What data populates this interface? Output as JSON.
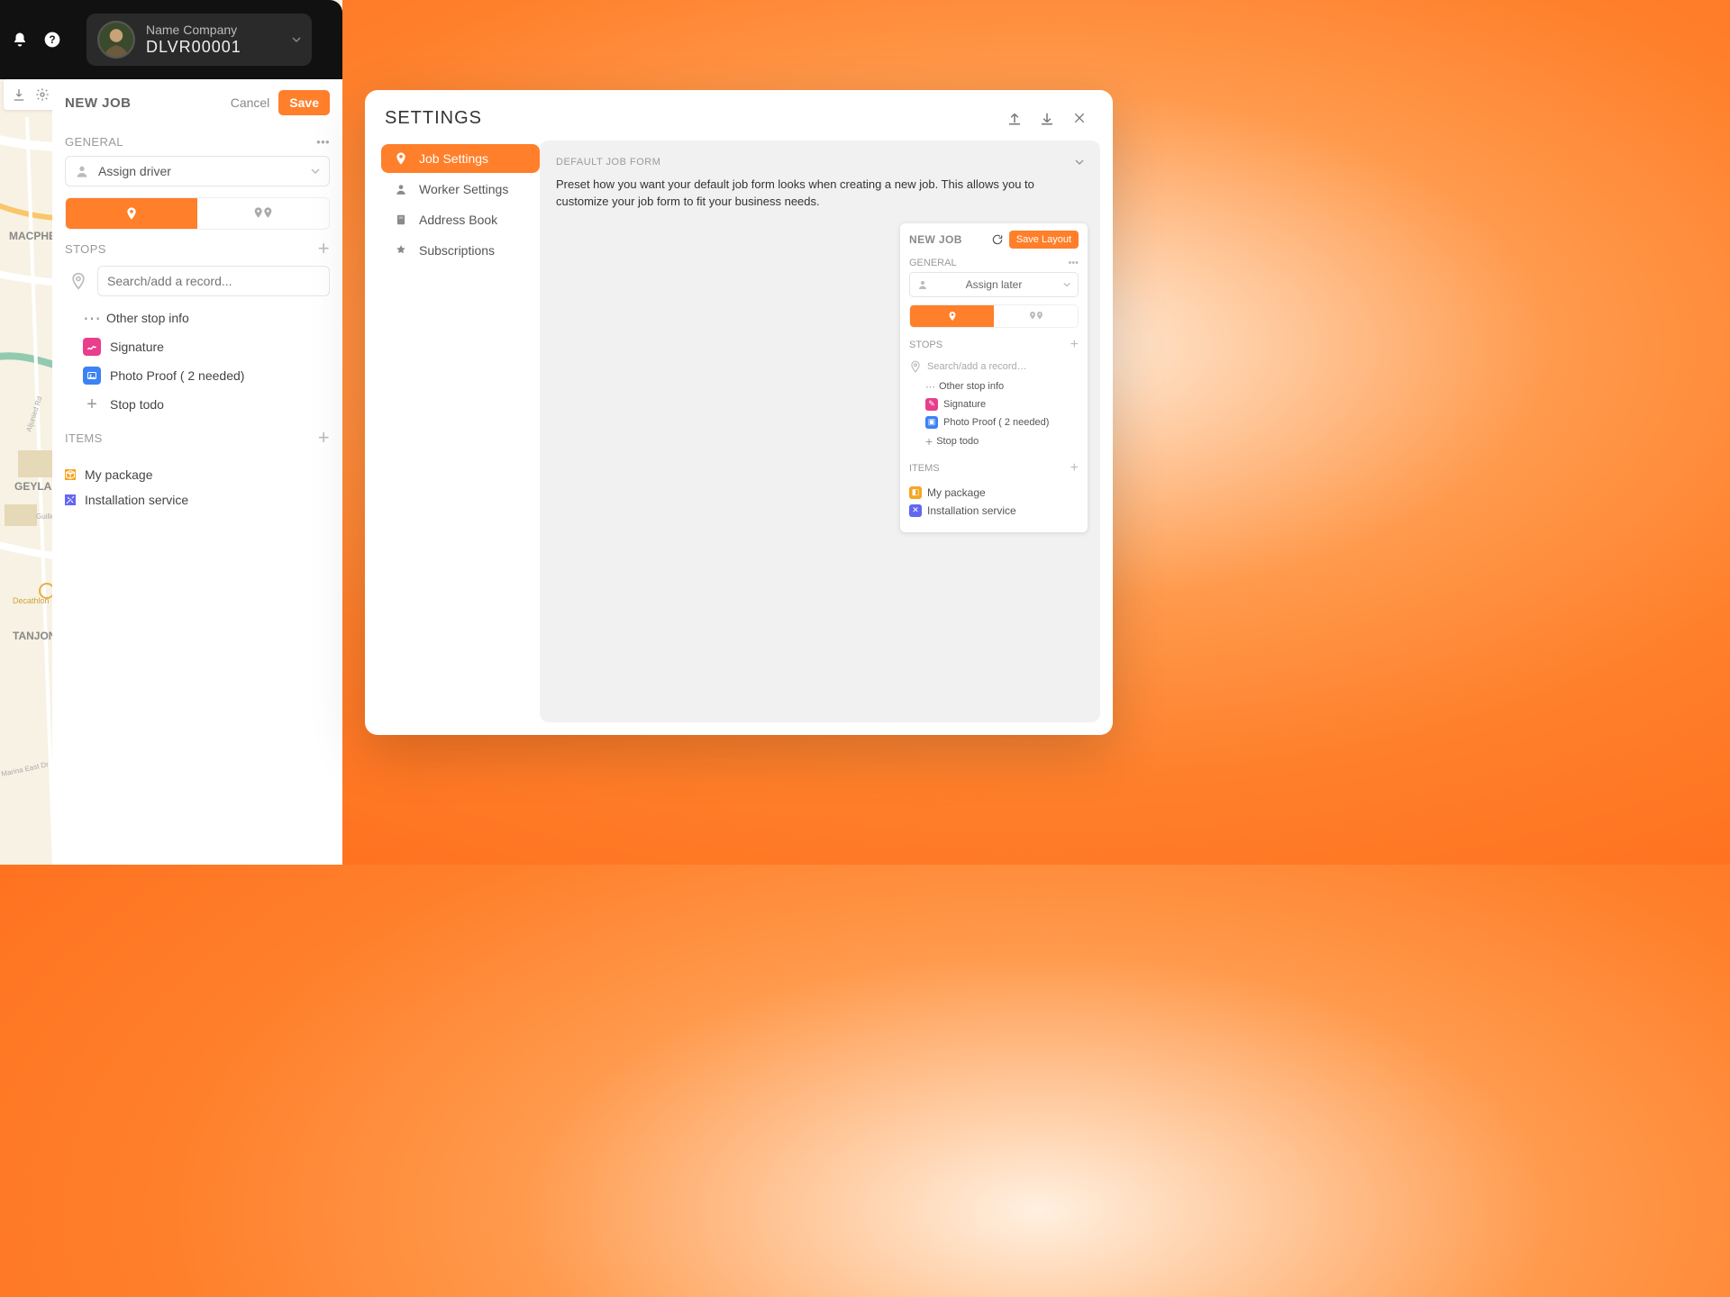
{
  "topbar": {
    "company_name": "Name Company",
    "company_code": "DLVR00001"
  },
  "leftPanel": {
    "title": "NEW JOB",
    "cancel": "Cancel",
    "save": "Save",
    "general": "GENERAL",
    "assign_driver": "Assign driver",
    "stops": "STOPS",
    "search_placeholder": "Search/add a record...",
    "other_stop_info": "Other stop info",
    "signature": "Signature",
    "photo_proof": "Photo Proof ( 2 needed)",
    "stop_todo": "Stop todo",
    "items": "ITEMS",
    "my_package": "My package",
    "installation": "Installation service"
  },
  "settings": {
    "title": "SETTINGS",
    "nav": {
      "job": "Job Settings",
      "worker": "Worker Settings",
      "address": "Address Book",
      "subs": "Subscriptions"
    },
    "section_head": "DEFAULT JOB FORM",
    "description": "Preset how you want your default job form looks when creating a new job. This allows you to customize your job form to fit your business needs.",
    "mini": {
      "title": "NEW JOB",
      "save": "Save Layout",
      "general": "GENERAL",
      "assign": "Assign later",
      "stops": "STOPS",
      "search": "Search/add a record…",
      "other": "Other stop info",
      "signature": "Signature",
      "photo": "Photo Proof ( 2 needed)",
      "todo": "Stop todo",
      "items": "ITEMS",
      "pkg": "My package",
      "install": "Installation service"
    }
  },
  "map": {
    "labels": [
      "MACPHERS",
      "GEYLANG",
      "TANJONG",
      "Decathlon",
      "Aljunied Rd",
      "Guillem",
      "Marina East Dr"
    ]
  }
}
